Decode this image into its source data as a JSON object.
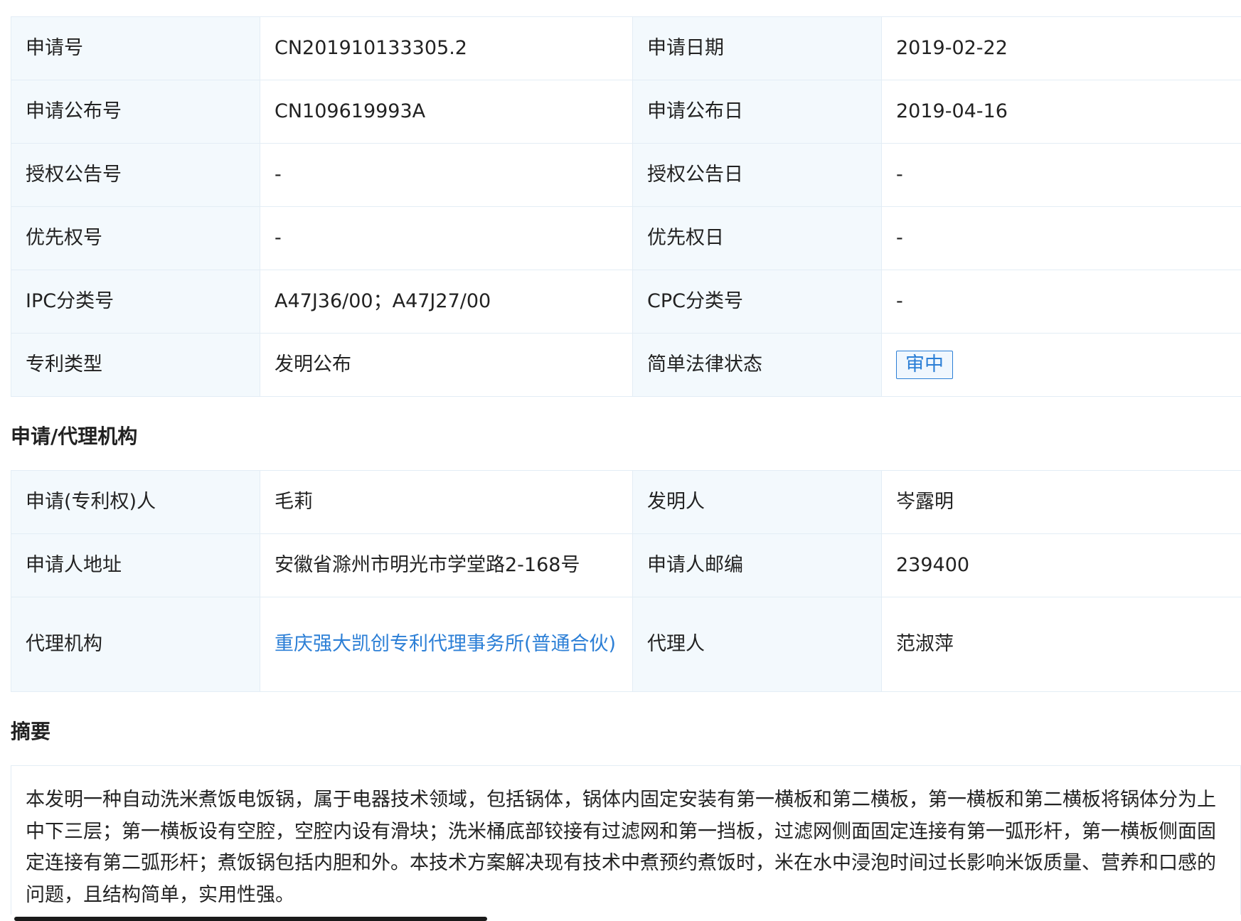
{
  "patent_info": {
    "rows": [
      {
        "label1": "申请号",
        "value1": "CN201910133305.2",
        "label2": "申请日期",
        "value2": "2019-02-22"
      },
      {
        "label1": "申请公布号",
        "value1": "CN109619993A",
        "label2": "申请公布日",
        "value2": "2019-04-16"
      },
      {
        "label1": "授权公告号",
        "value1": "-",
        "label2": "授权公告日",
        "value2": "-"
      },
      {
        "label1": "优先权号",
        "value1": "-",
        "label2": "优先权日",
        "value2": "-"
      },
      {
        "label1": "IPC分类号",
        "value1": "A47J36/00；A47J27/00",
        "label2": "CPC分类号",
        "value2": "-"
      },
      {
        "label1": "专利类型",
        "value1": "发明公布",
        "label2": "简单法律状态",
        "value2": "审中"
      }
    ]
  },
  "applicant_section": {
    "title": "申请/代理机构",
    "rows": [
      {
        "label1": "申请(专利权)人",
        "value1": "毛莉",
        "label2": "发明人",
        "value2": "岑露明"
      },
      {
        "label1": "申请人地址",
        "value1": "安徽省滁州市明光市学堂路2-168号",
        "label2": "申请人邮编",
        "value2": "239400"
      },
      {
        "label1": "代理机构",
        "value1": "重庆强大凯创专利代理事务所(普通合伙)",
        "label2": "代理人",
        "value2": "范淑萍"
      }
    ]
  },
  "abstract_section": {
    "title": "摘要",
    "text": "本发明一种自动洗米煮饭电饭锅，属于电器技术领域，包括锅体，锅体内固定安装有第一横板和第二横板，第一横板和第二横板将锅体分为上中下三层；第一横板设有空腔，空腔内设有滑块；洗米桶底部铰接有过滤网和第一挡板，过滤网侧面固定连接有第一弧形杆，第一横板侧面固定连接有第二弧形杆；煮饭锅包括内胆和外。本技术方案解决现有技术中煮预约煮饭时，米在水中浸泡时间过长影响米饭质量、营养和口感的问题，且结构简单，实用性强。"
  },
  "colors": {
    "label_bg": "#f3f9fd",
    "border": "#e3edf5",
    "link": "#2c7fd6"
  }
}
